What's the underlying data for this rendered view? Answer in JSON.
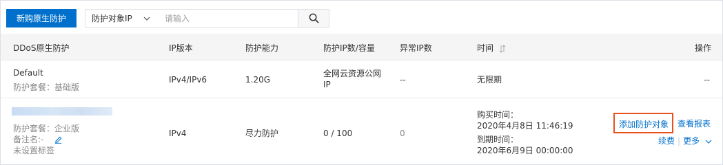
{
  "toolbar": {
    "buy_button": "新购原生防护",
    "filter_select": "防护对象IP",
    "search_placeholder": "请输入"
  },
  "table": {
    "headers": {
      "name": "DDoS原生防护",
      "ip_version": "IP版本",
      "capacity": "防护能力",
      "ip_count": "防护IP数/容量",
      "abnormal_ip": "异常IP数",
      "time": "时间",
      "actions": "操作"
    },
    "rows": [
      {
        "name": "Default",
        "package": "防护套餐：基础版",
        "ip_version": "IPv4/IPv6",
        "capacity": "1.20G",
        "ip_count_line1": "全网云资源公网",
        "ip_count_line2": "IP",
        "abnormal_ip": "--",
        "time": "无限期",
        "actions": "--"
      },
      {
        "package": "防护套餐：企业版",
        "remark": "备注名:-",
        "tags": "未设置标签",
        "ip_version": "IPv4",
        "capacity": "尽力防护",
        "ip_count": "0 / 100",
        "abnormal_ip": "0",
        "buy_time_label": "购买时间：",
        "buy_time": "2020年4月8日 11:46:19",
        "expire_time_label": "到期时间：",
        "expire_time": "2020年6月9日 00:00:00",
        "action_add": "添加防护对象",
        "action_report": "查看报表",
        "action_renew": "续费",
        "action_more": "更多"
      }
    ]
  },
  "colors": {
    "primary": "#0070cc",
    "highlight_border": "#e8501f"
  }
}
